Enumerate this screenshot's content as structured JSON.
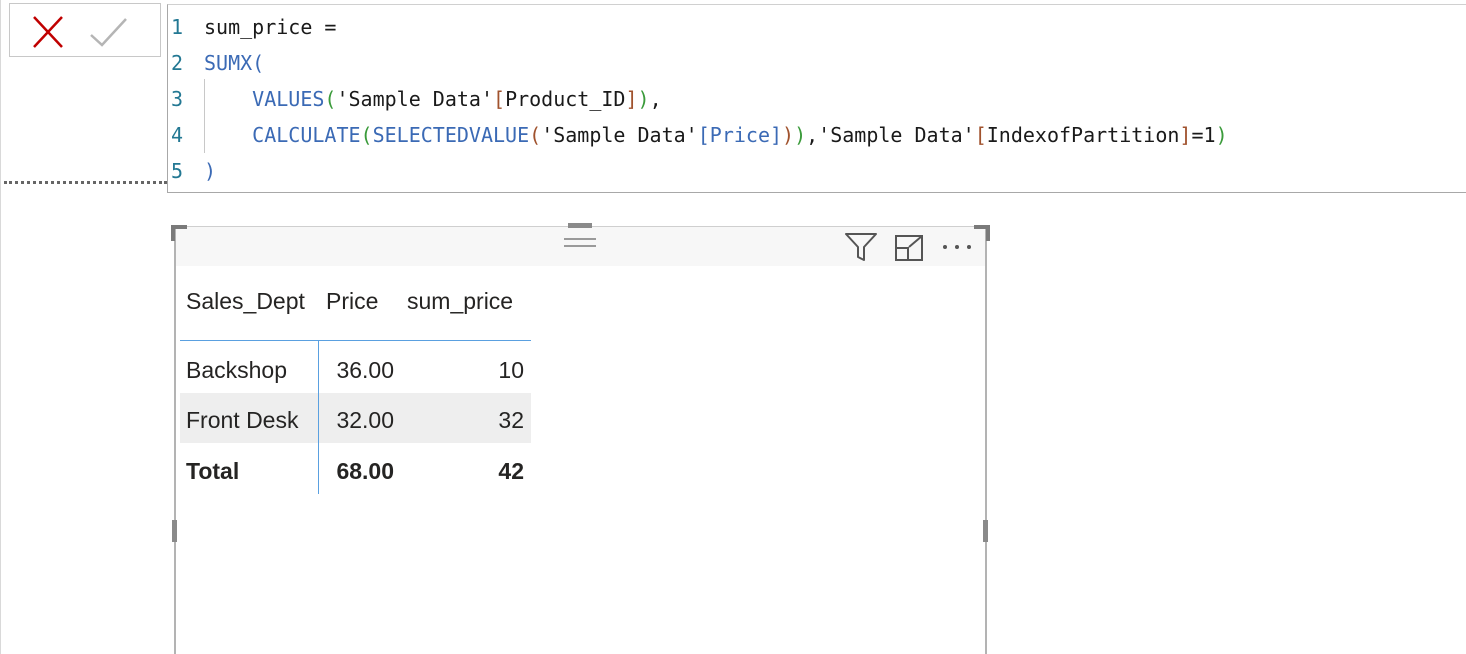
{
  "formula_bar": {
    "cancel_icon": "close-icon",
    "confirm_icon": "check-icon",
    "lines": [
      {
        "num": "1",
        "segments": [
          {
            "cls": "plain",
            "text": "sum_price ="
          }
        ]
      },
      {
        "num": "2",
        "segments": [
          {
            "cls": "fn",
            "text": "SUMX("
          }
        ]
      },
      {
        "num": "3",
        "segments": [
          {
            "cls": "plain",
            "text": "    "
          },
          {
            "cls": "fn",
            "text": "VALUES"
          },
          {
            "cls": "b2",
            "text": "("
          },
          {
            "cls": "str",
            "text": "'Sample Data'"
          },
          {
            "cls": "b3",
            "text": "["
          },
          {
            "cls": "col",
            "text": "Product_ID"
          },
          {
            "cls": "b3",
            "text": "]"
          },
          {
            "cls": "b2",
            "text": ")"
          },
          {
            "cls": "plain",
            "text": ","
          }
        ]
      },
      {
        "num": "4",
        "segments": [
          {
            "cls": "plain",
            "text": "    "
          },
          {
            "cls": "fn",
            "text": "CALCULATE"
          },
          {
            "cls": "b2",
            "text": "("
          },
          {
            "cls": "fn",
            "text": "SELECTEDVALUE"
          },
          {
            "cls": "b3",
            "text": "("
          },
          {
            "cls": "str",
            "text": "'Sample Data'"
          },
          {
            "cls": "fn",
            "text": "[Price]"
          },
          {
            "cls": "b3",
            "text": ")"
          },
          {
            "cls": "b2",
            "text": ")"
          },
          {
            "cls": "plain",
            "text": ","
          },
          {
            "cls": "str",
            "text": "'Sample Data'"
          },
          {
            "cls": "b3",
            "text": "["
          },
          {
            "cls": "col",
            "text": "IndexofPartition"
          },
          {
            "cls": "b3",
            "text": "]"
          },
          {
            "cls": "plain",
            "text": "=1"
          },
          {
            "cls": "b2",
            "text": ")"
          }
        ]
      },
      {
        "num": "5",
        "segments": [
          {
            "cls": "fn",
            "text": ")"
          }
        ]
      }
    ]
  },
  "visual": {
    "header_icons": [
      "filter-icon",
      "focus-mode-icon",
      "more-options-icon"
    ],
    "table": {
      "columns": [
        "Sales_Dept",
        "Price",
        "sum_price"
      ],
      "rows": [
        {
          "dept": "Backshop",
          "price": "36.00",
          "sum_price": "10"
        },
        {
          "dept": "Front Desk",
          "price": "32.00",
          "sum_price": "32"
        }
      ],
      "total": {
        "label": "Total",
        "price": "68.00",
        "sum_price": "42"
      }
    }
  },
  "colors": {
    "function": "#3b6ab5",
    "line_number": "#237893",
    "table_rule": "#5aa0e0",
    "cancel": "#c00000"
  }
}
